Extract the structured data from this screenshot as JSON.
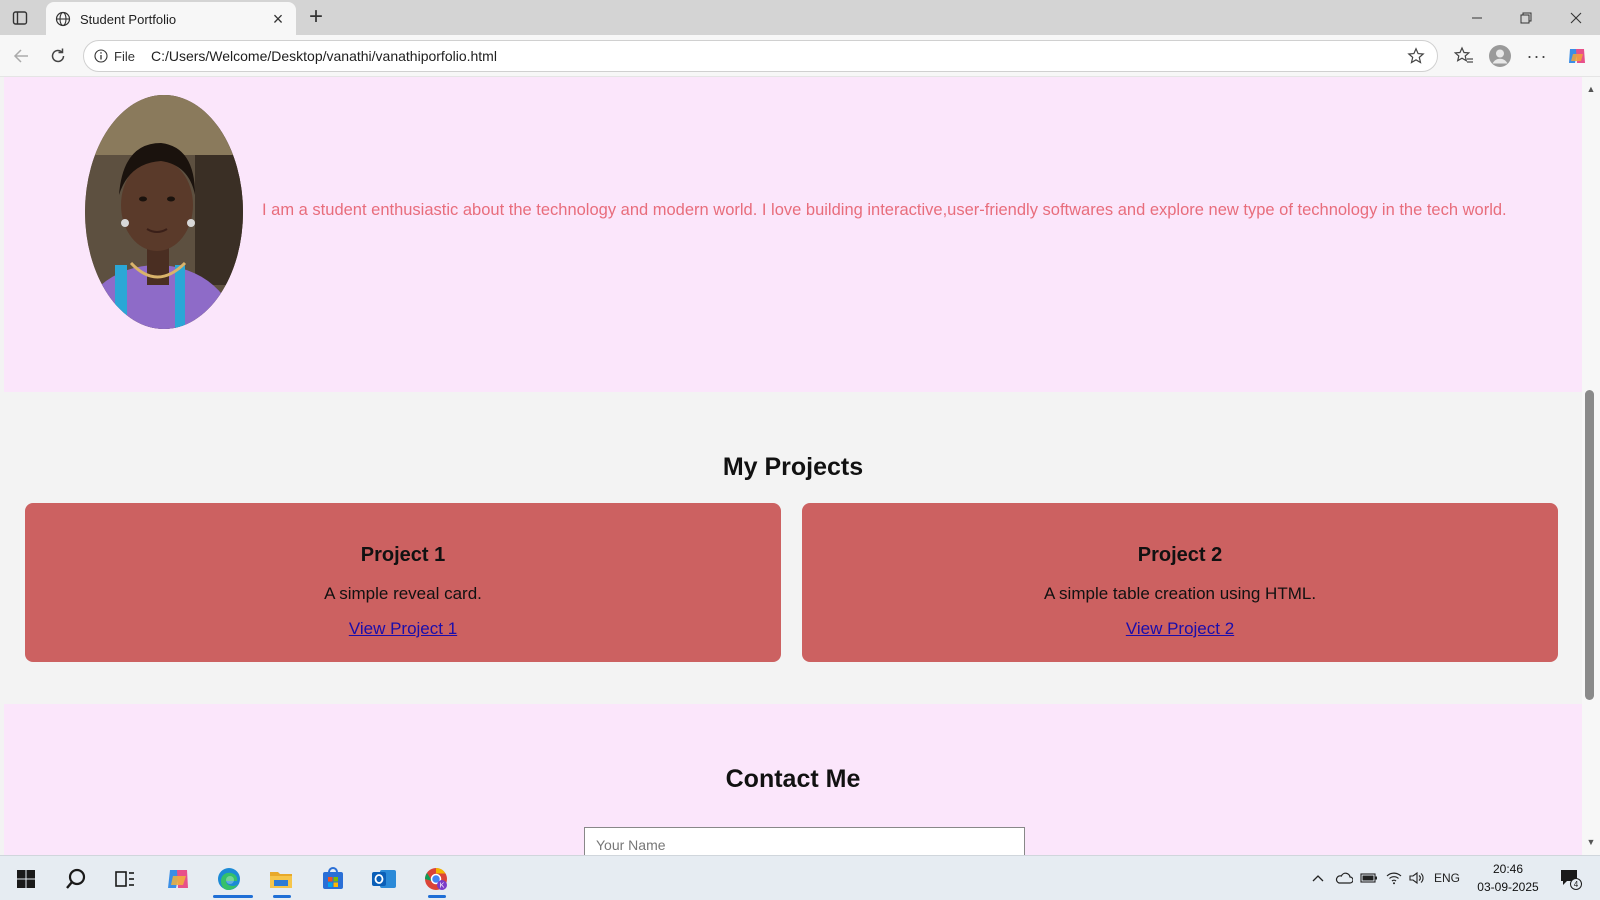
{
  "browser": {
    "tab_title": "Student Portfolio",
    "address_scheme": "File",
    "url": "C:/Users/Welcome/Desktop/vanathi/vanathiporfolio.html"
  },
  "about": {
    "text": "I am a student enthusiastic about the technology and modern world. I love building interactive,user-friendly softwares and explore new type of technology in the tech world."
  },
  "projects": {
    "heading": "My Projects",
    "items": [
      {
        "title": "Project 1",
        "description": "A simple reveal card.",
        "link": "View Project 1"
      },
      {
        "title": "Project 2",
        "description": "A simple table creation using HTML.",
        "link": "View Project 2"
      }
    ]
  },
  "contact": {
    "heading": "Contact Me",
    "name_placeholder": "Your Name"
  },
  "taskbar": {
    "language": "ENG",
    "time": "20:46",
    "date": "03-09-2025",
    "notification_count": "4"
  },
  "colors": {
    "about_bg": "#fbe6fb",
    "about_text": "#e86d7c",
    "card_bg": "#cc6161",
    "link": "#1a0dab"
  }
}
